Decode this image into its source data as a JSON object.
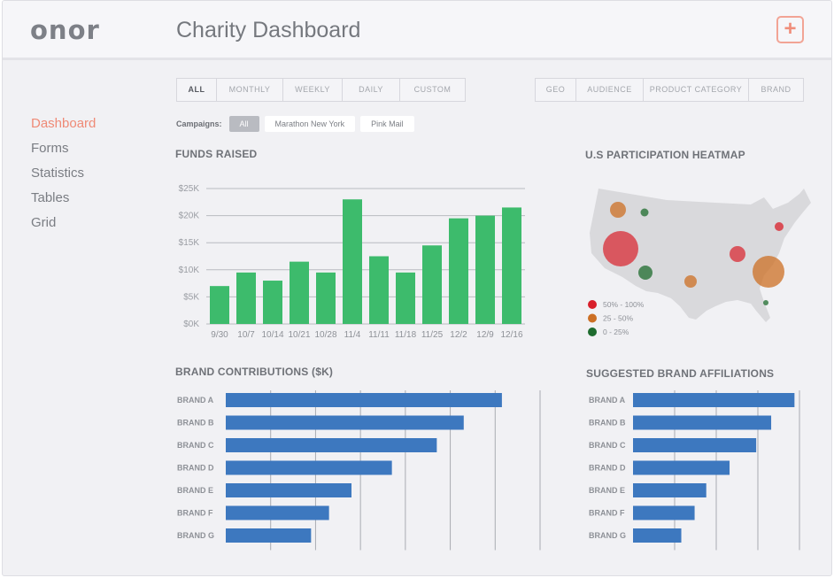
{
  "app": {
    "logo": "onor",
    "title": "Charity Dashboard",
    "add_icon": "plus-icon"
  },
  "sidebar": {
    "items": [
      {
        "label": "Dashboard",
        "active": true
      },
      {
        "label": "Forms",
        "active": false
      },
      {
        "label": "Statistics",
        "active": false
      },
      {
        "label": "Tables",
        "active": false
      },
      {
        "label": "Grid",
        "active": false
      }
    ]
  },
  "period_tabs": [
    "ALL",
    "MONTHLY",
    "WEEKLY",
    "DAILY",
    "CUSTOM"
  ],
  "period_active": "ALL",
  "dimension_tabs": [
    "GEO",
    "AUDIENCE",
    "PRODUCT CATEGORY",
    "BRAND"
  ],
  "campaigns": {
    "label": "Campaigns:",
    "options": [
      "All",
      "Marathon New York",
      "Pink Mail"
    ],
    "selected": "All"
  },
  "colors": {
    "accent": "#ef8a76",
    "green_bar": "#3dbb6c",
    "blue_bar": "#3d78bf"
  },
  "chart_data": [
    {
      "id": "funds",
      "type": "bar",
      "title": "FUNDS RAISED",
      "categories": [
        "9/30",
        "10/7",
        "10/14",
        "10/21",
        "10/28",
        "11/4",
        "11/11",
        "11/18",
        "11/25",
        "12/2",
        "12/9",
        "12/16"
      ],
      "values": [
        7,
        9.5,
        8,
        11.5,
        9.5,
        23,
        12.5,
        9.5,
        14.5,
        19.5,
        20,
        21.5
      ],
      "ylim": [
        0,
        25
      ],
      "yticks": [
        "$0K",
        "$5K",
        "$10K",
        "$15K",
        "$20K",
        "$25K"
      ],
      "grid": true
    },
    {
      "id": "heatmap",
      "type": "scatter",
      "title": "U.S PARTICIPATION HEATMAP",
      "legend": [
        {
          "label": "50% - 100%",
          "color": "#d81f2a"
        },
        {
          "label": "25 - 50%",
          "color": "#cc6f24"
        },
        {
          "label": "0 - 25%",
          "color": "#1e6b2e"
        }
      ]
    },
    {
      "id": "brand_contrib",
      "type": "bar",
      "orientation": "horizontal",
      "title": "BRAND CONTRIBUTIONS ($K)",
      "categories": [
        "BRAND A",
        "BRAND B",
        "BRAND C",
        "BRAND D",
        "BRAND E",
        "BRAND F",
        "BRAND G"
      ],
      "values": [
        61.5,
        53,
        47,
        37,
        28,
        23,
        19
      ],
      "xlim": [
        0,
        70
      ],
      "xticks": [
        "$0",
        "$10",
        "$20",
        "$30",
        "$40",
        "$50",
        "$60",
        "$70"
      ],
      "grid": true
    },
    {
      "id": "affiliations",
      "type": "bar",
      "orientation": "horizontal",
      "title": "SUGGESTED BRAND AFFILIATIONS",
      "categories": [
        "BRAND A",
        "BRAND B",
        "BRAND C",
        "BRAND D",
        "BRAND E",
        "BRAND F",
        "BRAND G"
      ],
      "values": [
        970,
        830,
        740,
        580,
        440,
        370,
        290
      ],
      "xlim": [
        0,
        1000
      ],
      "xticks": [
        "0",
        "250",
        "500",
        "750",
        "1000"
      ],
      "grid": true
    }
  ]
}
